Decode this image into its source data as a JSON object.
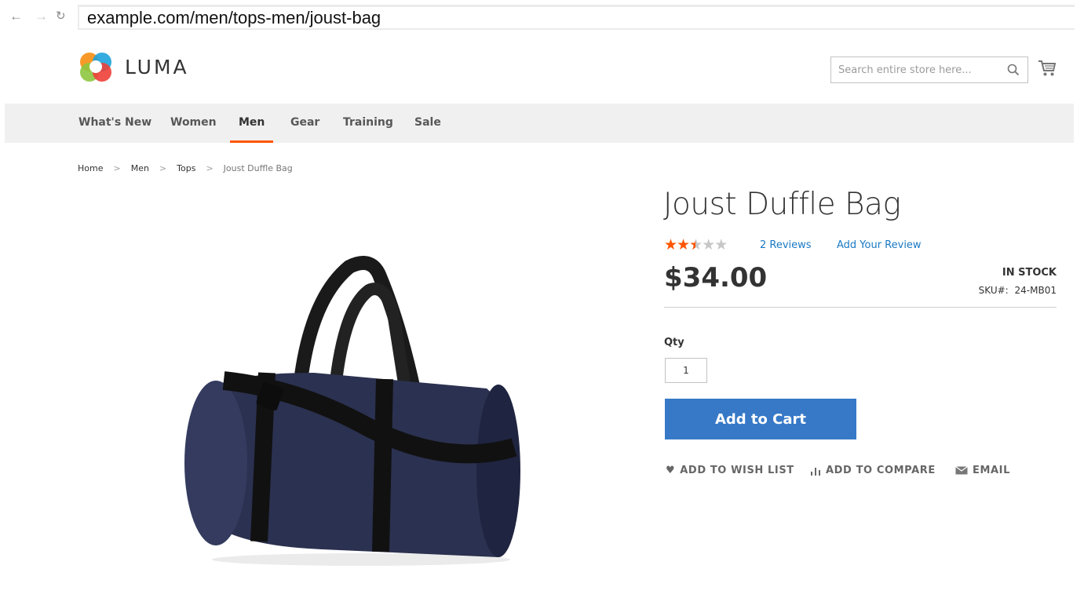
{
  "browser": {
    "back_icon": "arrow-left-icon",
    "forward_icon": "arrow-right-icon",
    "reload_icon": "reload-icon",
    "url": "example.com/men/tops-men/joust-bag"
  },
  "header": {
    "logo_text": "LUMA",
    "search_placeholder": "Search entire store here...",
    "search_icon": "search-icon",
    "cart_icon": "cart-icon"
  },
  "nav": {
    "items": [
      {
        "label": "What's New",
        "active": false
      },
      {
        "label": "Women",
        "active": false
      },
      {
        "label": "Men",
        "active": true
      },
      {
        "label": "Gear",
        "active": false
      },
      {
        "label": "Training",
        "active": false
      },
      {
        "label": "Sale",
        "active": false
      }
    ],
    "accent_color": "#ff5501"
  },
  "breadcrumb": {
    "items": [
      "Home",
      "Men",
      "Tops",
      "Joust Duffle Bag"
    ],
    "separator": ">"
  },
  "product": {
    "title": "Joust Duffle Bag",
    "rating_stars": 2.5,
    "rating_max": 5,
    "reviews_link": "2 Reviews",
    "add_review_link": "Add Your Review",
    "price": "$34.00",
    "stock": "IN STOCK",
    "sku_label": "SKU#:",
    "sku_value": "24-MB01",
    "qty_label": "Qty",
    "qty_value": "1",
    "add_to_cart": "Add to Cart",
    "button_color": "#3779c7",
    "actions": [
      {
        "label": "ADD TO WISH LIST",
        "icon": "heart-icon"
      },
      {
        "label": "ADD TO COMPARE",
        "icon": "compare-icon"
      },
      {
        "label": "EMAIL",
        "icon": "envelope-icon"
      }
    ]
  }
}
